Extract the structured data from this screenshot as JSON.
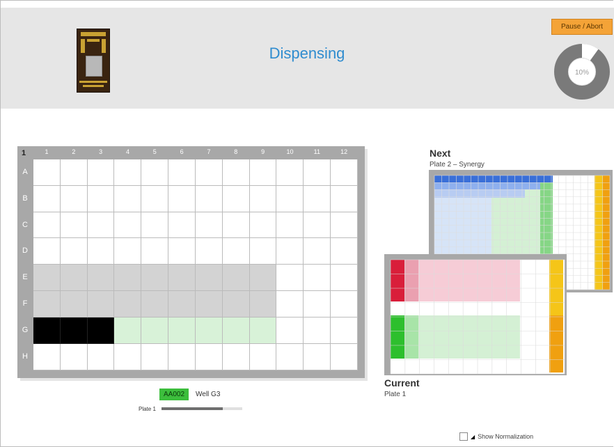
{
  "header": {
    "title": "Dispensing",
    "pause_label": "Pause / Abort",
    "progress_percent": 10,
    "progress_text": "10%"
  },
  "main_plate": {
    "corner_label": "1",
    "columns": [
      "1",
      "2",
      "3",
      "4",
      "5",
      "6",
      "7",
      "8",
      "9",
      "10",
      "11",
      "12"
    ],
    "rows": [
      "A",
      "B",
      "C",
      "D",
      "E",
      "F",
      "G",
      "H"
    ]
  },
  "status": {
    "sample_badge": "AA002",
    "well_label": "Well G3",
    "plate_label": "Plate 1",
    "plate_progress_fraction": 0.76,
    "colors": {
      "badge": "#3cbe3c"
    }
  },
  "next": {
    "title": "Next",
    "subtitle": "Plate 2 – Synergy"
  },
  "current": {
    "title": "Current",
    "subtitle": "Plate 1"
  },
  "footer": {
    "show_normalization_label": "Show Normalization"
  },
  "colors": {
    "accent": "#2f8ccf",
    "pause": "#f4a337",
    "ring_bg": "#7a7a7a",
    "ring_fill": "#ffffff",
    "well_gray": "#d3d3d3",
    "well_black": "#000000",
    "well_green": "#d8f2d8"
  },
  "icons": {
    "chip": "chip-image",
    "pointer": "cursor-icon"
  }
}
